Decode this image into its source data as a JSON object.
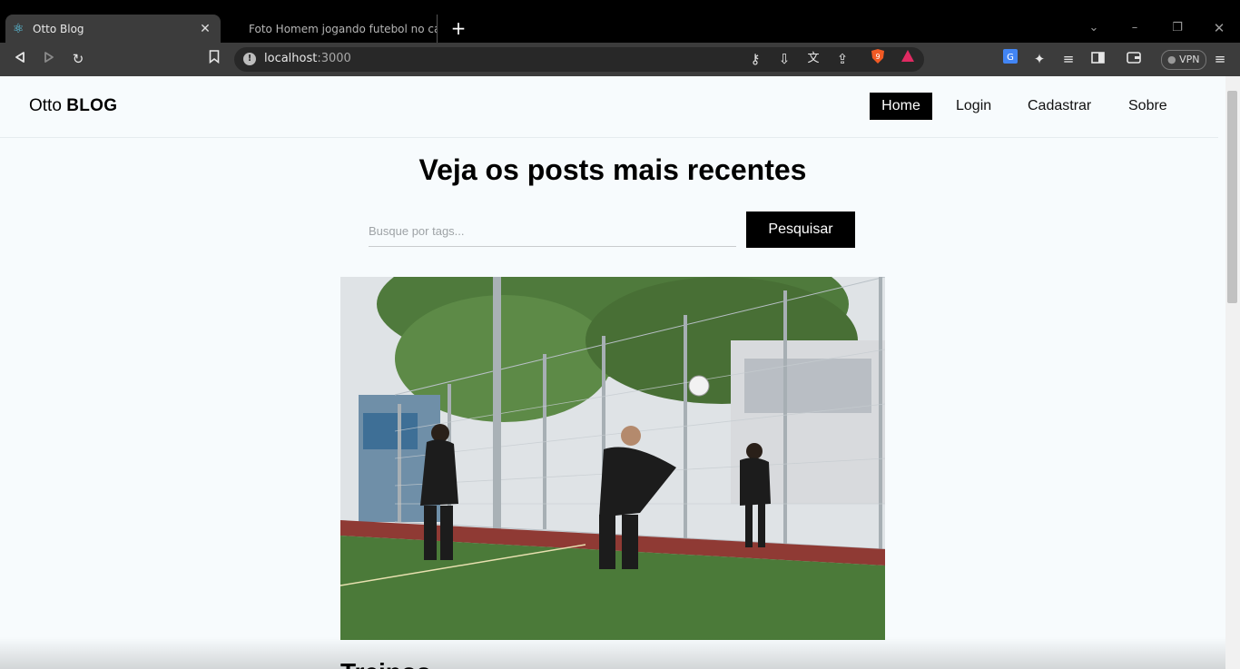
{
  "browser": {
    "tabs": [
      {
        "title": "Otto Blog",
        "active": true
      },
      {
        "title": "Foto Homem jogando futebol no cam",
        "active": false
      }
    ],
    "url_host": "localhost",
    "url_port": ":3000",
    "vpn_label": "VPN"
  },
  "site": {
    "logo_regular": "Otto",
    "logo_bold": "BLOG",
    "nav": [
      "Home",
      "Login",
      "Cadastrar",
      "Sobre"
    ]
  },
  "main": {
    "headline": "Veja os posts mais recentes",
    "search_placeholder": "Busque por tags...",
    "search_button": "Pesquisar",
    "post_title": "Treinos"
  }
}
